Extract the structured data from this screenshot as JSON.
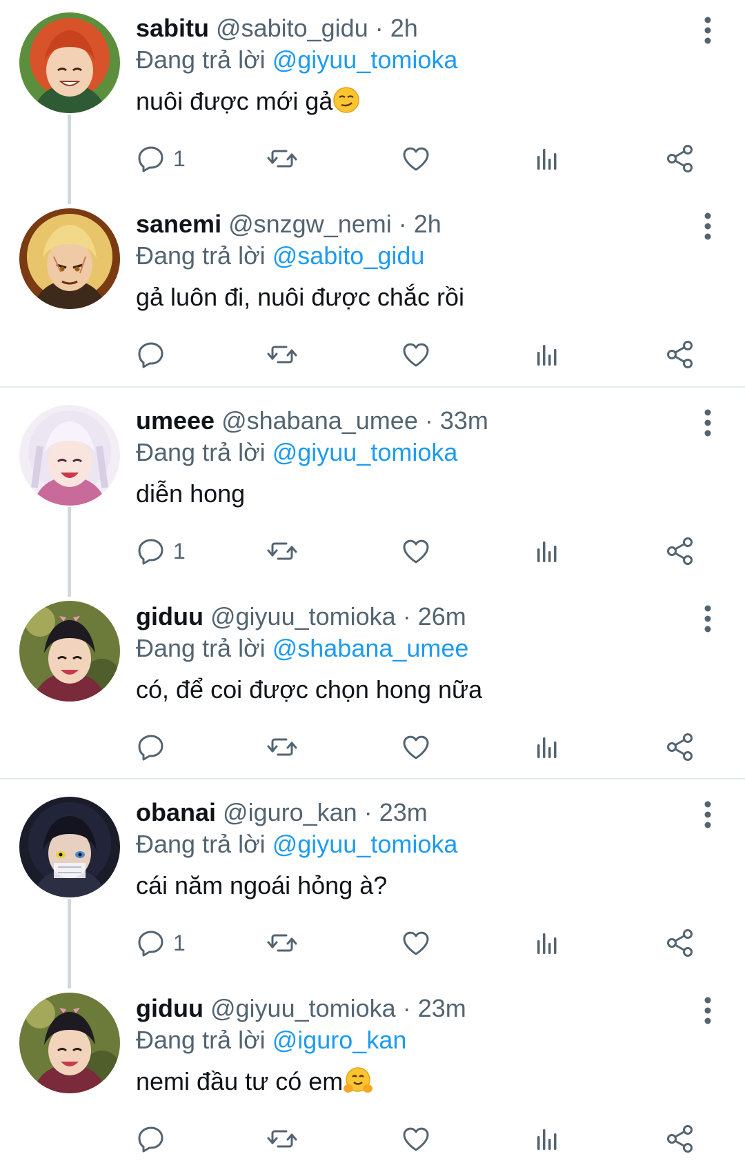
{
  "colors": {
    "link": "#1d9bf0",
    "muted": "#536471",
    "text": "#0f1419"
  },
  "reply_prefix": "Đang trả lời",
  "tweets": [
    {
      "name": "sabitu",
      "handle": "@sabito_gidu",
      "time": "2h",
      "reply_to": "@giyuu_tomioka",
      "text": "nuôi được mới gả",
      "emoji": "smirking-face-emoji",
      "reply_count": "1",
      "avatar": "orange-hair-character"
    },
    {
      "name": "sanemi",
      "handle": "@snzgw_nemi",
      "time": "2h",
      "reply_to": "@sabito_gidu",
      "text": "gả luôn đi, nuôi được chắc rồi",
      "emoji": "",
      "reply_count": "",
      "avatar": "blonde-hair-character"
    },
    {
      "name": "umeee",
      "handle": "@shabana_umee",
      "time": "33m",
      "reply_to": "@giyuu_tomioka",
      "text": "diễn hong",
      "emoji": "",
      "reply_count": "1",
      "avatar": "white-hair-character"
    },
    {
      "name": "giduu",
      "handle": "@giyuu_tomioka",
      "time": "26m",
      "reply_to": "@shabana_umee",
      "text": "có, để coi được chọn hong nữa",
      "emoji": "",
      "reply_count": "",
      "avatar": "dark-hair-character"
    },
    {
      "name": "obanai",
      "handle": "@iguro_kan",
      "time": "23m",
      "reply_to": "@giyuu_tomioka",
      "text": "cái năm ngoái hỏng à?",
      "emoji": "",
      "reply_count": "1",
      "avatar": "black-hair-character"
    },
    {
      "name": "giduu",
      "handle": "@giyuu_tomioka",
      "time": "23m",
      "reply_to": "@iguro_kan",
      "text": "nemi đầu tư có em",
      "emoji": "hugging-face-emoji",
      "reply_count": "",
      "avatar": "dark-hair-character"
    }
  ]
}
